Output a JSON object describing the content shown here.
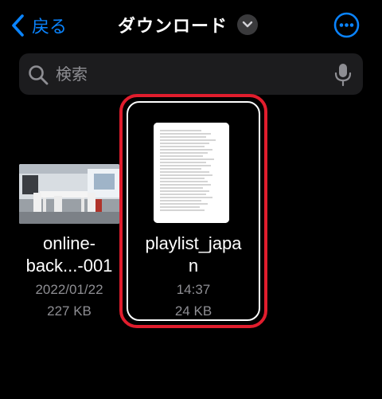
{
  "nav": {
    "back_label": "戻る",
    "title": "ダウンロード"
  },
  "search": {
    "placeholder": "検索"
  },
  "files": [
    {
      "name_line1": "online-",
      "name_line2": "back...-001",
      "date": "2022/01/22",
      "size": "227 KB",
      "thumbnail": "photo-interior-icon"
    },
    {
      "name_line1": "playlist_japa",
      "name_line2": "n",
      "date": "14:37",
      "size": "24 KB",
      "thumbnail": "document-icon",
      "selected": true
    }
  ],
  "colors": {
    "accent": "#0a84ff",
    "selection_highlight": "#e11d2d",
    "background": "#000000",
    "secondary_text": "#8e8e93"
  }
}
